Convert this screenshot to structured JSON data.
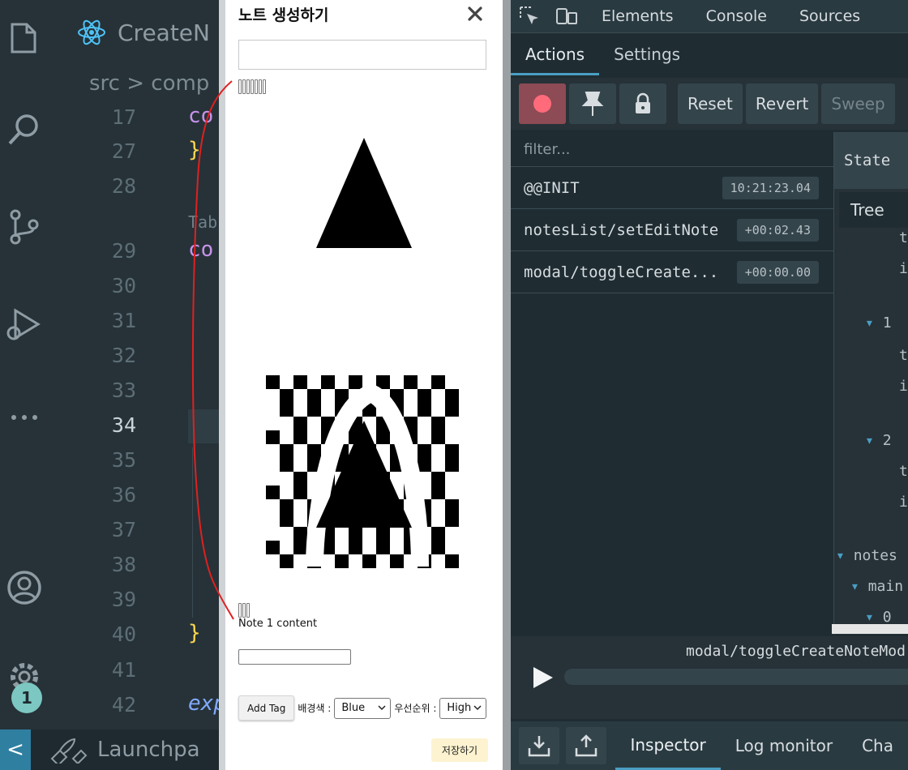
{
  "vscode": {
    "tab_title": "CreateN",
    "breadcrumb": "src > comp",
    "status_left": "<",
    "launch_label": "Launchpa",
    "badge_count": "1",
    "tab_inline_label": "Tab",
    "lines": [
      {
        "num": "17",
        "code": "co",
        "color": "#c792ea"
      },
      {
        "num": "27",
        "code": "}",
        "color": "#ffd54f"
      },
      {
        "num": "28",
        "code": "",
        "color": "#c792ea"
      },
      {
        "num": "29",
        "code": "co",
        "color": "#c792ea"
      },
      {
        "num": "30",
        "code": "",
        "color": "#c792ea"
      },
      {
        "num": "31",
        "code": "",
        "color": "#c792ea"
      },
      {
        "num": "32",
        "code": "",
        "color": "#c792ea"
      },
      {
        "num": "33",
        "code": "",
        "color": "#c792ea"
      },
      {
        "num": "34",
        "code": "",
        "color": "#c792ea"
      },
      {
        "num": "35",
        "code": "",
        "color": "#c792ea"
      },
      {
        "num": "36",
        "code": "",
        "color": "#c792ea"
      },
      {
        "num": "37",
        "code": "",
        "color": "#c792ea"
      },
      {
        "num": "38",
        "code": "",
        "color": "#c792ea"
      },
      {
        "num": "39",
        "code": "",
        "color": "#c792ea"
      },
      {
        "num": "40",
        "code": "}",
        "color": "#ffd54f"
      },
      {
        "num": "41",
        "code": "",
        "color": "#c792ea"
      },
      {
        "num": "42",
        "code": "exp",
        "color": "#82aaff"
      }
    ]
  },
  "modal": {
    "title": "노트 생성하기",
    "close_symbol": "✕",
    "note_content": "Note 1 content",
    "add_tag_label": "Add Tag",
    "bg_label": "배경색 :",
    "bg_value": "Blue",
    "priority_label": "우선순위 :",
    "priority_value": "High",
    "save_label": "저장하기"
  },
  "devtools": {
    "top_tabs": [
      "Elements",
      "Console",
      "Sources"
    ],
    "sub_tabs": [
      "Actions",
      "Settings"
    ],
    "buttons": {
      "reset": "Reset",
      "revert": "Revert",
      "sweep": "Sweep"
    },
    "filter_placeholder": "filter...",
    "actions": [
      {
        "name": "@@INIT",
        "time": "10:21:23.04"
      },
      {
        "name": "notesList/setEditNote",
        "time": "+00:02.43"
      },
      {
        "name": "modal/toggleCreate...",
        "time": "+00:00.00"
      }
    ],
    "state_tab": "State",
    "tree_tab": "Tree",
    "tree_items": {
      "i1": "1",
      "i2": "2",
      "notes": "notes",
      "main": "main",
      "zero": "0"
    },
    "slider_label": "modal/toggleCreateNoteMod",
    "bottom_tabs": [
      "Inspector",
      "Log monitor",
      "Cha"
    ]
  }
}
